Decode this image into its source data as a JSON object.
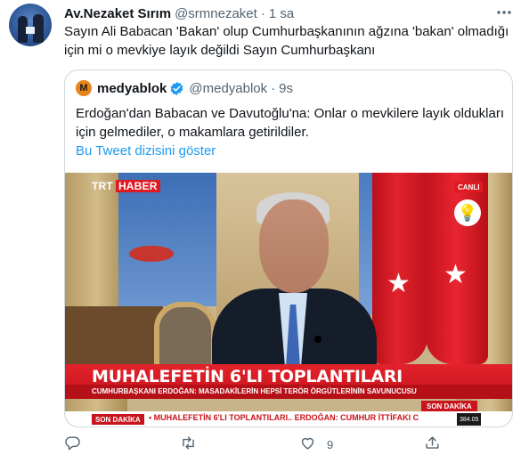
{
  "tweet": {
    "display_name": "Av.Nezaket Sırım",
    "handle": "@srmnezaket",
    "separator": "·",
    "time": "1 sa",
    "text": "Sayın Ali Babacan 'Bakan' olup Cumhurbaşkanının ağzına 'bakan' olmadığı için mi o mevkiye layık değildi Sayın Cumhurbaşkanı",
    "icons": {
      "avatar": "avatar-photo",
      "more": "more-icon"
    }
  },
  "quote": {
    "logo_letter": "M",
    "display_name": "medyablok",
    "verified_icon": "verified-badge-icon",
    "handle": "@medyablok",
    "separator": "·",
    "time": "9s",
    "text": "Erdoğan'dan Babacan ve Davutoğlu'na: Onlar o mevkilere layık oldukları için gelmediler, o makamlara getirildiler.",
    "thread_link": "Bu Tweet dizisini göster",
    "media": {
      "channel_name": "TRT",
      "channel_sub": "HABER",
      "live_label": "CANLI",
      "headline": "MUHALEFETİN 6'LI TOPLANTILARI",
      "subline": "CUMHURBAŞKANI ERDOĞAN: MASADAKİLERİN HEPSİ TERÖR ÖRGÜTLERİNİN SAVUNUCUSU",
      "breaking_tag": "SON DAKİKA",
      "ticker_tag": "SON DAKİKA",
      "ticker_text": "• MUHALEFETİN 6'LI TOPLANTILARI.. ERDOĞAN: CUMHUR İTTİFAKI C",
      "ticker_value": "384.05"
    }
  },
  "actions": {
    "reply_icon": "reply-icon",
    "retweet_icon": "retweet-icon",
    "like_icon": "like-icon",
    "like_count": "9",
    "share_icon": "share-icon"
  },
  "colors": {
    "link": "#1d9bf0",
    "secondary_text": "#536471",
    "primary_text": "#0f1419",
    "border": "#cfd9de",
    "verified": "#1d9bf0",
    "trt_red": "#e01a22"
  }
}
